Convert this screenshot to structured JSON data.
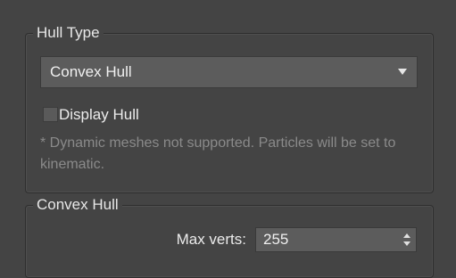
{
  "theme": {
    "panel_background": "#444444",
    "control_background": "#5c5c5c",
    "text": "#e6e6e6",
    "disabled_text": "#8a8a8a"
  },
  "hull_type": {
    "title": "Hull Type",
    "dropdown": {
      "selected": "Convex Hull",
      "icon": "chevron-down-icon"
    },
    "display_hull": {
      "label": "Display Hull",
      "checked": false
    },
    "note": "* Dynamic meshes not supported. Particles will be set to kinematic."
  },
  "convex_hull": {
    "title": "Convex Hull",
    "max_verts": {
      "label": "Max verts:",
      "value": "255",
      "icon": "spinner-arrows-icon"
    }
  }
}
